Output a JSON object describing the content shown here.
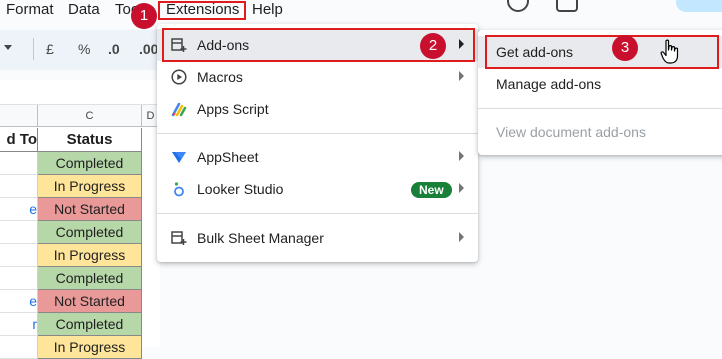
{
  "menubar": {
    "items": [
      "Format",
      "Data",
      "Too",
      "Extensions",
      "Help"
    ]
  },
  "toolbar": {
    "currency": "£",
    "percent": "%",
    "decrease_decimals": ".0",
    "increase_decimals": ".00"
  },
  "sheet": {
    "col_c_header": "C",
    "col_d_header": "D",
    "header_left": "d To",
    "header_status": "Status",
    "left_fragments": [
      "",
      "",
      "e",
      "",
      "",
      "",
      "e",
      "r",
      ""
    ],
    "rows": [
      {
        "status": "Completed",
        "color": "#b6d7a8"
      },
      {
        "status": "In Progress",
        "color": "#ffe599"
      },
      {
        "status": "Not Started",
        "color": "#ea9999"
      },
      {
        "status": "Completed",
        "color": "#b6d7a8"
      },
      {
        "status": "In Progress",
        "color": "#ffe599"
      },
      {
        "status": "Completed",
        "color": "#b6d7a8"
      },
      {
        "status": "Not Started",
        "color": "#ea9999"
      },
      {
        "status": "Completed",
        "color": "#b6d7a8"
      },
      {
        "status": "In Progress",
        "color": "#ffe599"
      }
    ]
  },
  "extensions_menu": {
    "items": [
      {
        "label": "Add-ons",
        "icon": "addons-icon"
      },
      {
        "label": "Macros",
        "icon": "play-circle-icon"
      },
      {
        "label": "Apps Script",
        "icon": "apps-script-icon"
      },
      {
        "label": "AppSheet",
        "icon": "appsheet-icon"
      },
      {
        "label": "Looker Studio",
        "icon": "looker-studio-icon",
        "badge": "New"
      },
      {
        "label": "Bulk Sheet Manager",
        "icon": "addons-icon"
      }
    ]
  },
  "addons_submenu": {
    "items": [
      "Get add-ons",
      "Manage add-ons",
      "View document add-ons"
    ]
  },
  "steps": [
    "1",
    "2",
    "3"
  ],
  "colors": {
    "highlight_red": "#e01b1b",
    "step_badge": "#c8102e",
    "new_badge": "#188038",
    "hover": "#e8eaed"
  }
}
